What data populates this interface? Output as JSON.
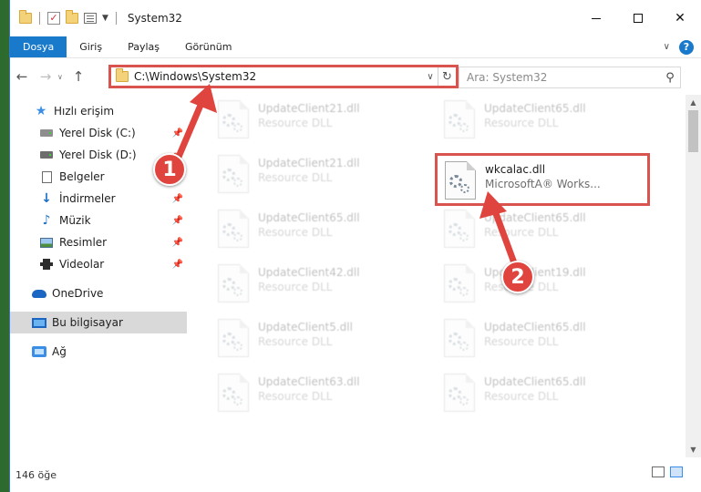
{
  "window": {
    "title": "System32"
  },
  "ribbon": {
    "tabs": [
      "Dosya",
      "Giriş",
      "Paylaş",
      "Görünüm"
    ],
    "help": "?"
  },
  "nav": {
    "back": "←",
    "forward": "→",
    "up": "↑",
    "address": "C:\\Windows\\System32",
    "search_placeholder": "Ara: System32"
  },
  "sidebar": {
    "items": [
      {
        "label": "Hızlı erişim",
        "icon": "star-icon",
        "pinned": false
      },
      {
        "label": "Yerel Disk (C:)",
        "icon": "drive-c-icon",
        "pinned": true
      },
      {
        "label": "Yerel Disk (D:)",
        "icon": "drive-d-icon",
        "pinned": true
      },
      {
        "label": "Belgeler",
        "icon": "documents-icon",
        "pinned": true
      },
      {
        "label": "İndirmeler",
        "icon": "downloads-icon",
        "pinned": true
      },
      {
        "label": "Müzik",
        "icon": "music-icon",
        "pinned": true
      },
      {
        "label": "Resimler",
        "icon": "pictures-icon",
        "pinned": true
      },
      {
        "label": "Videolar",
        "icon": "videos-icon",
        "pinned": true
      },
      {
        "label": "OneDrive",
        "icon": "onedrive-icon",
        "pinned": false
      },
      {
        "label": "Bu bilgisayar",
        "icon": "this-pc-icon",
        "pinned": false,
        "selected": true
      },
      {
        "label": "Ağ",
        "icon": "network-icon",
        "pinned": false
      }
    ]
  },
  "files": {
    "left": [
      {
        "name": "UpdateClient21.dll",
        "desc": "Resource DLL"
      },
      {
        "name": "UpdateClient21.dll",
        "desc": "Resource DLL"
      },
      {
        "name": "UpdateClient65.dll",
        "desc": "Resource DLL"
      },
      {
        "name": "UpdateClient42.dll",
        "desc": "Resource DLL"
      },
      {
        "name": "UpdateClient5.dll",
        "desc": "Resource DLL"
      },
      {
        "name": "UpdateClient63.dll",
        "desc": "Resource DLL"
      }
    ],
    "right": [
      {
        "name": "UpdateClient65.dll",
        "desc": "Resource DLL"
      },
      {
        "name": "wkcalac.dll",
        "desc": "MicrosoftA® Works...",
        "highlight": true
      },
      {
        "name": "UpdateClient65.dll",
        "desc": "Resource DLL"
      },
      {
        "name": "UpdateClient19.dll",
        "desc": "Resource DLL"
      },
      {
        "name": "UpdateClient65.dll",
        "desc": "Resource DLL"
      },
      {
        "name": "UpdateClient65.dll",
        "desc": "Resource DLL"
      }
    ]
  },
  "status": {
    "count": "146 öğe"
  },
  "callouts": {
    "one": "1",
    "two": "2"
  },
  "colors": {
    "accent": "#1979ca",
    "annotation": "#e0443e"
  }
}
